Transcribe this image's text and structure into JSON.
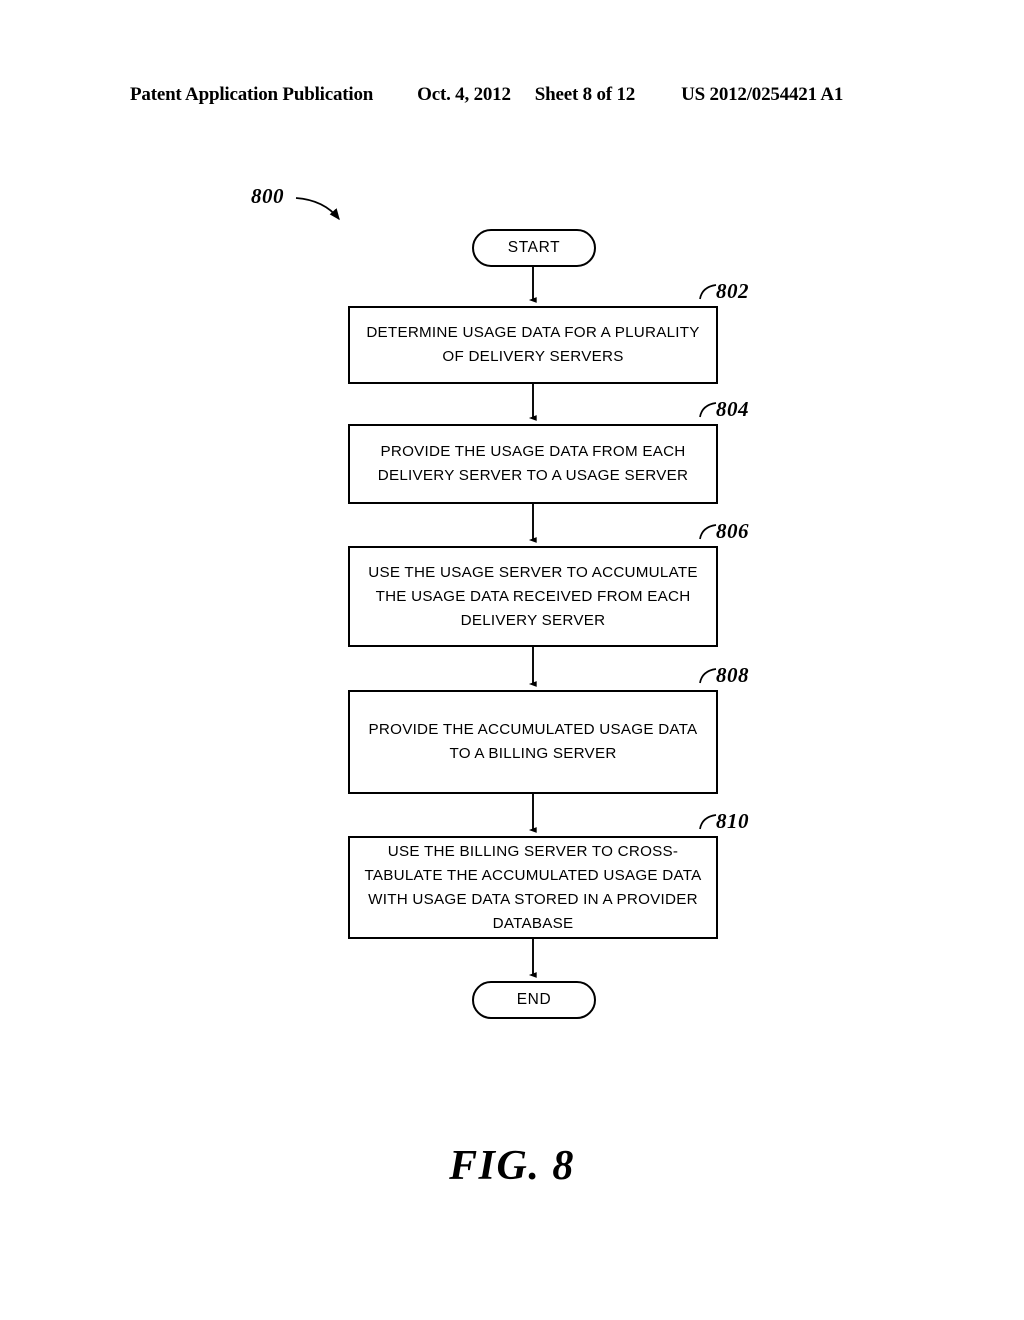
{
  "header": {
    "publication": "Patent Application Publication",
    "date": "Oct. 4, 2012",
    "sheet": "Sheet 8 of 12",
    "patent_number": "US 2012/0254421 A1"
  },
  "figure": {
    "caption": "FIG. 8",
    "diagram_reference": "800",
    "type": "flowchart"
  },
  "flowchart": {
    "start_label": "START",
    "end_label": "END",
    "steps": [
      {
        "ref": "802",
        "text": "DETERMINE USAGE DATA FOR A PLURALITY\nOF DELIVERY SERVERS"
      },
      {
        "ref": "804",
        "text": "PROVIDE THE USAGE DATA FROM EACH\nDELIVERY SERVER TO A USAGE SERVER"
      },
      {
        "ref": "806",
        "text": "USE THE USAGE SERVER TO ACCUMULATE\nTHE USAGE DATA RECEIVED FROM EACH\nDELIVERY SERVER"
      },
      {
        "ref": "808",
        "text": "PROVIDE THE ACCUMULATED USAGE DATA\nTO A BILLING SERVER"
      },
      {
        "ref": "810",
        "text": "USE THE BILLING SERVER TO CROSS-\nTABULATE THE ACCUMULATED USAGE DATA\nWITH USAGE DATA STORED IN A PROVIDER\nDATABASE"
      }
    ]
  },
  "colors": {
    "ink": "#000000",
    "paper": "#ffffff"
  }
}
